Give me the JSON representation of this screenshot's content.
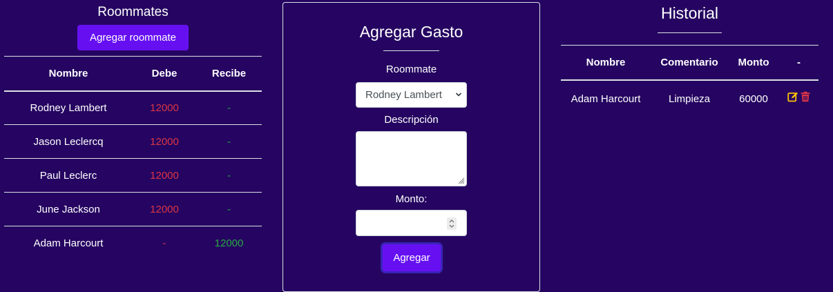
{
  "roommates": {
    "title": "Roommates",
    "add_button": "Agregar roommate",
    "columns": [
      "Nombre",
      "Debe",
      "Recibe"
    ],
    "rows": [
      {
        "nombre": "Rodney Lambert",
        "debe": "12000",
        "recibe": "-"
      },
      {
        "nombre": "Jason Leclercq",
        "debe": "12000",
        "recibe": "-"
      },
      {
        "nombre": "Paul Leclerc",
        "debe": "12000",
        "recibe": "-"
      },
      {
        "nombre": "June Jackson",
        "debe": "12000",
        "recibe": "-"
      },
      {
        "nombre": "Adam Harcourt",
        "debe": "-",
        "recibe": "12000"
      }
    ]
  },
  "gasto": {
    "title": "Agregar Gasto",
    "roommate_label": "Roommate",
    "roommate_selected": "Rodney Lambert",
    "descripcion_label": "Descripción",
    "monto_label": "Monto:",
    "submit_label": "Agregar"
  },
  "historial": {
    "title": "Historial",
    "columns": [
      "Nombre",
      "Comentario",
      "Monto",
      "-"
    ],
    "rows": [
      {
        "nombre": "Adam Harcourt",
        "comentario": "Limpieza",
        "monto": "60000"
      }
    ]
  },
  "colors": {
    "background": "#250561",
    "primary_button": "#6610f2",
    "debt_red": "#dc3545",
    "credit_green": "#28a745",
    "edit_icon": "#ffc107",
    "delete_icon": "#dc3545"
  },
  "icons": [
    "chevron-down-icon",
    "resize-grip-icon",
    "spinner-icon",
    "edit-icon",
    "trash-icon"
  ]
}
